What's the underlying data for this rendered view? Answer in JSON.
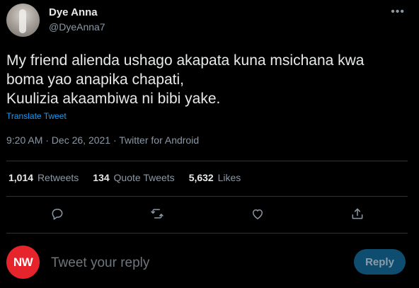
{
  "author": {
    "name": "Dye Anna",
    "handle": "@DyeAnna7"
  },
  "more_icon": "more-horizontal-icon",
  "tweet": {
    "lines": [
      "My friend alienda ushago akapata kuna msichana kwa",
      "boma yao anapika chapati,",
      "Kuulizia akaambiwa ni bibi yake."
    ],
    "translate_label": "Translate Tweet",
    "meta": "9:20 AM · Dec 26, 2021 · Twitter for Android"
  },
  "stats": {
    "retweets": {
      "count": "1,014",
      "label": "Retweets"
    },
    "quote_tweets": {
      "count": "134",
      "label": "Quote Tweets"
    },
    "likes": {
      "count": "5,632",
      "label": "Likes"
    }
  },
  "actions": [
    "reply-icon",
    "retweet-icon",
    "like-icon",
    "share-icon"
  ],
  "reply": {
    "avatar_text": "NW",
    "placeholder": "Tweet your reply",
    "button_label": "Reply"
  },
  "colors": {
    "background": "#000000",
    "text": "#e7e9ea",
    "muted": "#8b98a5",
    "link": "#1d9bf0",
    "reply_button": "#0e4d6f",
    "avatar_red": "#e5242c"
  }
}
